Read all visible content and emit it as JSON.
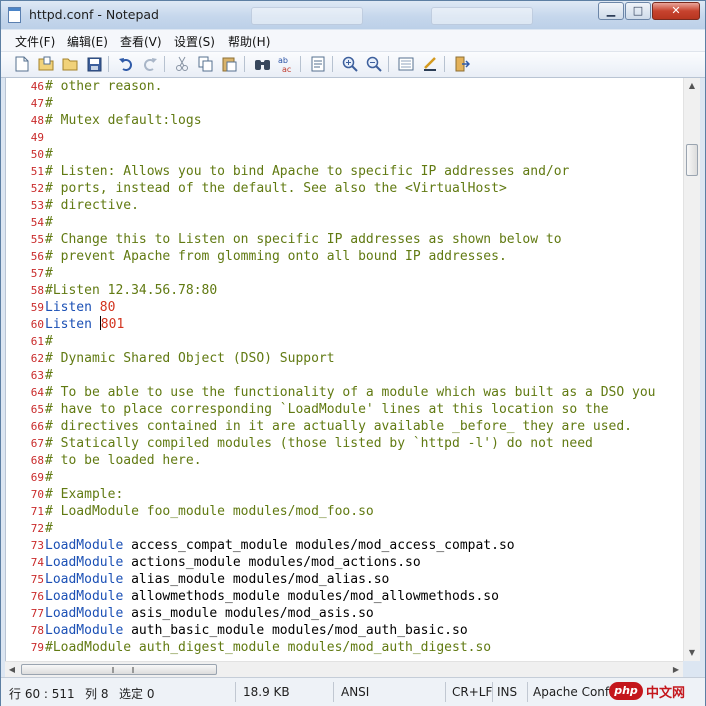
{
  "window": {
    "title": "httpd.conf - Notepad",
    "controls": {
      "minimize": "▁",
      "maximize": "□",
      "close": "✕"
    }
  },
  "menu": [
    "文件(F)",
    "编辑(E)",
    "查看(V)",
    "设置(S)",
    "帮助(H)"
  ],
  "toolbar": {
    "icons": [
      "new-file-icon",
      "open-file-icon",
      "open-folder-icon",
      "save-icon",
      "undo-icon",
      "redo-icon",
      "cut-icon",
      "copy-icon",
      "paste-icon",
      "find-icon",
      "replace-icon",
      "page-icon",
      "zoom-in-icon",
      "zoom-out-icon",
      "view-icon",
      "edit-check-icon",
      "exit-icon"
    ]
  },
  "editor": {
    "lines": [
      {
        "n": "46",
        "parts": [
          {
            "t": "# other reason.",
            "c": "cm"
          }
        ]
      },
      {
        "n": "47",
        "parts": [
          {
            "t": "#",
            "c": "cm"
          }
        ]
      },
      {
        "n": "48",
        "parts": [
          {
            "t": "# Mutex default:logs",
            "c": "cm"
          }
        ]
      },
      {
        "n": "49",
        "parts": []
      },
      {
        "n": "50",
        "parts": [
          {
            "t": "#",
            "c": "cm"
          }
        ]
      },
      {
        "n": "51",
        "parts": [
          {
            "t": "# Listen: Allows you to bind Apache to specific IP addresses and/or",
            "c": "cm"
          }
        ]
      },
      {
        "n": "52",
        "parts": [
          {
            "t": "# ports, instead of the default. See also the <VirtualHost>",
            "c": "cm"
          }
        ]
      },
      {
        "n": "53",
        "parts": [
          {
            "t": "# directive.",
            "c": "cm"
          }
        ]
      },
      {
        "n": "54",
        "parts": [
          {
            "t": "#",
            "c": "cm"
          }
        ]
      },
      {
        "n": "55",
        "parts": [
          {
            "t": "# Change this to Listen on specific IP addresses as shown below to",
            "c": "cm"
          }
        ]
      },
      {
        "n": "56",
        "parts": [
          {
            "t": "# prevent Apache from glomming onto all bound IP addresses.",
            "c": "cm"
          }
        ]
      },
      {
        "n": "57",
        "parts": [
          {
            "t": "#",
            "c": "cm"
          }
        ]
      },
      {
        "n": "58",
        "parts": [
          {
            "t": "#Listen 12.34.56.78:80",
            "c": "cm"
          }
        ]
      },
      {
        "n": "59",
        "parts": [
          {
            "t": "Listen ",
            "c": "kw"
          },
          {
            "t": "80",
            "c": "nm"
          }
        ]
      },
      {
        "n": "60",
        "parts": [
          {
            "t": "Listen ",
            "c": "kw"
          },
          {
            "t": "",
            "c": "caret"
          },
          {
            "t": "801",
            "c": "nm"
          }
        ]
      },
      {
        "n": "61",
        "parts": [
          {
            "t": "#",
            "c": "cm"
          }
        ]
      },
      {
        "n": "62",
        "parts": [
          {
            "t": "# Dynamic Shared Object (DSO) Support",
            "c": "cm"
          }
        ]
      },
      {
        "n": "63",
        "parts": [
          {
            "t": "#",
            "c": "cm"
          }
        ]
      },
      {
        "n": "64",
        "parts": [
          {
            "t": "# To be able to use the functionality of a module which was built as a DSO you",
            "c": "cm"
          }
        ]
      },
      {
        "n": "65",
        "parts": [
          {
            "t": "# have to place corresponding `LoadModule' lines at this location so the",
            "c": "cm"
          }
        ]
      },
      {
        "n": "66",
        "parts": [
          {
            "t": "# directives contained in it are actually available _before_ they are used.",
            "c": "cm"
          }
        ]
      },
      {
        "n": "67",
        "parts": [
          {
            "t": "# Statically compiled modules (those listed by `httpd -l') do not need",
            "c": "cm"
          }
        ]
      },
      {
        "n": "68",
        "parts": [
          {
            "t": "# to be loaded here.",
            "c": "cm"
          }
        ]
      },
      {
        "n": "69",
        "parts": [
          {
            "t": "#",
            "c": "cm"
          }
        ]
      },
      {
        "n": "70",
        "parts": [
          {
            "t": "# Example:",
            "c": "cm"
          }
        ]
      },
      {
        "n": "71",
        "parts": [
          {
            "t": "# LoadModule foo_module modules/mod_foo.so",
            "c": "cm"
          }
        ]
      },
      {
        "n": "72",
        "parts": [
          {
            "t": "#",
            "c": "cm"
          }
        ]
      },
      {
        "n": "73",
        "parts": [
          {
            "t": "LoadModule ",
            "c": "kw"
          },
          {
            "t": "access_compat_module modules/mod_access_compat.so",
            "c": "tx"
          }
        ]
      },
      {
        "n": "74",
        "parts": [
          {
            "t": "LoadModule ",
            "c": "kw"
          },
          {
            "t": "actions_module modules/mod_actions.so",
            "c": "tx"
          }
        ]
      },
      {
        "n": "75",
        "parts": [
          {
            "t": "LoadModule ",
            "c": "kw"
          },
          {
            "t": "alias_module modules/mod_alias.so",
            "c": "tx"
          }
        ]
      },
      {
        "n": "76",
        "parts": [
          {
            "t": "LoadModule ",
            "c": "kw"
          },
          {
            "t": "allowmethods_module modules/mod_allowmethods.so",
            "c": "tx"
          }
        ]
      },
      {
        "n": "77",
        "parts": [
          {
            "t": "LoadModule ",
            "c": "kw"
          },
          {
            "t": "asis_module modules/mod_asis.so",
            "c": "tx"
          }
        ]
      },
      {
        "n": "78",
        "parts": [
          {
            "t": "LoadModule ",
            "c": "kw"
          },
          {
            "t": "auth_basic_module modules/mod_auth_basic.so",
            "c": "tx"
          }
        ]
      },
      {
        "n": "79",
        "parts": [
          {
            "t": "#LoadModule auth_digest_module modules/mod_auth_digest.so",
            "c": "cm"
          }
        ]
      }
    ]
  },
  "status": {
    "position": "行 60 : 511",
    "column": "列 8",
    "selection": "选定 0",
    "size": "18.9 KB",
    "encoding": "ANSI",
    "line_ending": "CR+LF",
    "insert_mode": "INS",
    "syntax": "Apache Config"
  },
  "watermark": {
    "logo": "php",
    "text": "中文网"
  },
  "colors": {
    "comment": "#617a12",
    "keyword": "#1b50b5",
    "number": "#d2341f",
    "line_number": "#c92a2a"
  }
}
